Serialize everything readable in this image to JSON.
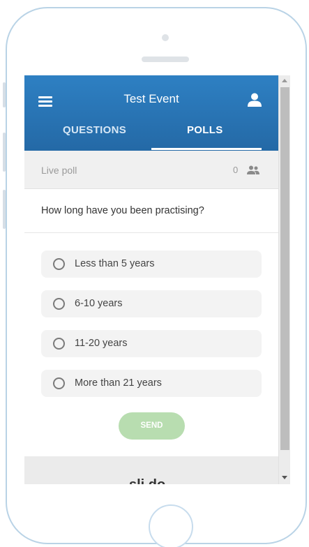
{
  "app_bar": {
    "title": "Test Event",
    "tabs": [
      {
        "label": "QUESTIONS",
        "active": false
      },
      {
        "label": "POLLS",
        "active": true
      }
    ],
    "accent_color": "#2a75b6"
  },
  "poll": {
    "status_label": "Live poll",
    "participant_count": "0",
    "question": "How long have you been practising?",
    "options": [
      {
        "label": "Less than 5 years",
        "selected": false
      },
      {
        "label": "6-10 years",
        "selected": false
      },
      {
        "label": "11-20 years",
        "selected": false
      },
      {
        "label": "More than 21 years",
        "selected": false
      }
    ],
    "send_label": "SEND",
    "send_color": "#b8ddb0"
  },
  "footer": {
    "brand_partial": "sli.do"
  },
  "icons": {
    "menu": "hamburger-menu-icon",
    "user": "user-icon",
    "participants": "people-icon",
    "radio": "radio-unchecked-icon"
  }
}
